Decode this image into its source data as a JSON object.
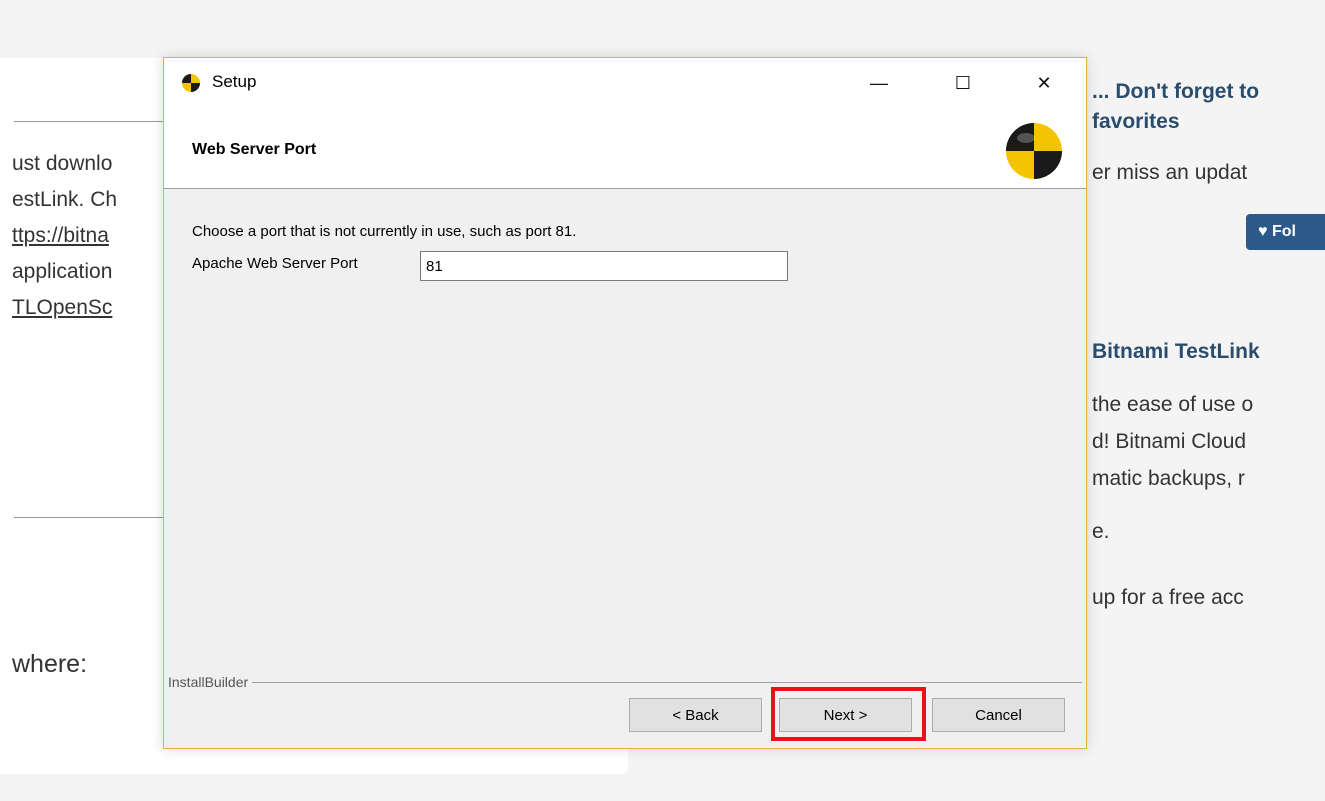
{
  "background_page": {
    "left_lines": [
      "ust downlo",
      "estLink. Ch",
      "ttps://bitna",
      "application",
      "TLOpenSc"
    ],
    "where_text": "where:",
    "right_heading_1a": "... Don't forget to",
    "right_heading_1b": "favorites",
    "right_text_1": "er miss an updat",
    "follow_button": "Fol",
    "right_heading_2": "Bitnami TestLink",
    "right_lines": [
      "the ease of use o",
      "d! Bitnami Cloud",
      "matic backups, r",
      "e."
    ],
    "right_text_signup": "up for a free acc"
  },
  "dialog": {
    "title": "Setup",
    "window_controls": {
      "minimize": "—",
      "maximize": "☐",
      "close": "✕"
    },
    "header_title": "Web Server Port",
    "instruction": "Choose a port that is not currently in use, such as port 81.",
    "port_label": "Apache Web Server Port",
    "port_value": "81",
    "footer_brand": "InstallBuilder",
    "buttons": {
      "back": "< Back",
      "next": "Next >",
      "cancel": "Cancel"
    },
    "highlighted_button": "next",
    "highlight_color": "#e8121a"
  },
  "icons": {
    "app_icon": "bitnami-logo-icon",
    "header_logo": "bitnami-logo-icon"
  }
}
